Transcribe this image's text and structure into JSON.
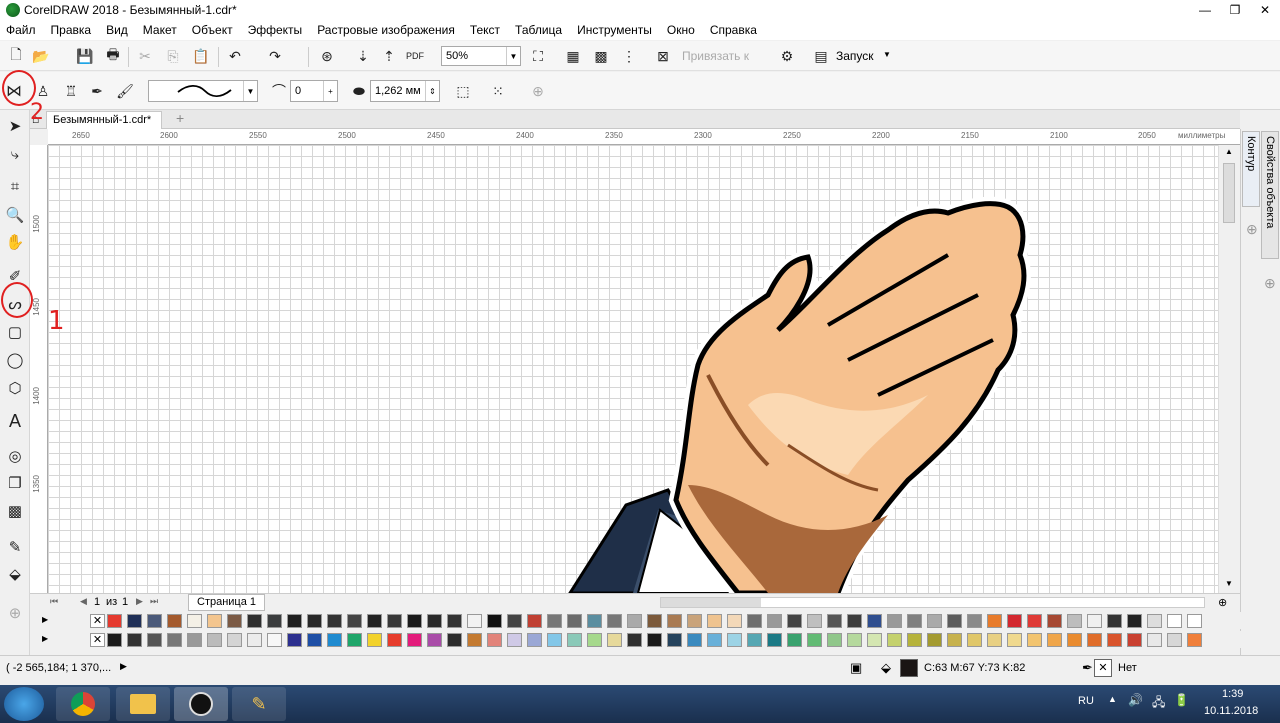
{
  "window": {
    "title": "CorelDRAW 2018 - Безымянный-1.cdr*",
    "min": "—",
    "max": "❐",
    "close": "✕"
  },
  "menu": [
    "Файл",
    "Правка",
    "Вид",
    "Макет",
    "Объект",
    "Эффекты",
    "Растровые изображения",
    "Текст",
    "Таблица",
    "Инструменты",
    "Окно",
    "Справка"
  ],
  "std": {
    "zoom": "50%",
    "snap": "Привязать к",
    "launch": "Запуск"
  },
  "prop": {
    "smooth": "0",
    "outline": "1,262 мм"
  },
  "doc": {
    "tab": "Безымянный-1.cdr*",
    "units": "миллиметры"
  },
  "hruler": [
    "2650",
    "2600",
    "2550",
    "2500",
    "2450",
    "2400",
    "2350",
    "2300",
    "2250",
    "2200",
    "2150",
    "2100",
    "2050"
  ],
  "vruler": [
    "1500",
    "1450",
    "1400",
    "1350"
  ],
  "pager": {
    "current": "1",
    "of": "из",
    "total": "1",
    "page_tab": "Страница 1"
  },
  "dock": {
    "tab1": "Контур",
    "tab2": "Свойства объекта"
  },
  "status": {
    "coords": "( -2 565,184; 1 370,... ",
    "fill_label": "C:63 M:67 Y:73 K:82",
    "outline_label": "Нет"
  },
  "annotations": {
    "a1": "1",
    "a2": "2"
  },
  "taskbar": {
    "lang": "RU",
    "time": "1:39",
    "date": "10.11.2018"
  },
  "palette_row1": [
    "#e53a2f",
    "#1f2f57",
    "#4b5a7a",
    "#a45a2d",
    "#f4f0e6",
    "#f3c58e",
    "#7b5a45",
    "#2e2e2e",
    "#3b3d3e",
    "#1f1f1f",
    "#282828",
    "#333",
    "#444",
    "#222",
    "#383838",
    "#1a1a1a",
    "#2a2a2a",
    "#333",
    "#f2f2f2",
    "#111",
    "#444",
    "#c04033",
    "#777",
    "#6b6b6b",
    "#5b8ea0",
    "#777",
    "#aaa",
    "#7c5a3b",
    "#a97a52",
    "#c9a37a",
    "#efc38f",
    "#f3d8b8",
    "#6e6e6e",
    "#999",
    "#444",
    "#bfbfbf",
    "#555",
    "#3c3c3c",
    "#2f4e8f",
    "#999",
    "#7f7f7f",
    "#aaa",
    "#5c5c5c",
    "#8a8a8a",
    "#e87b2b",
    "#d3282f",
    "#df3a36",
    "#a64832",
    "#bdbdbd",
    "#f0f0f0",
    "#333",
    "#222",
    "#ddd",
    "#fff",
    "#fff"
  ],
  "palette_row2": [
    "#1b1b1b",
    "#333",
    "#555",
    "#777",
    "#999",
    "#bbb",
    "#d4d4d4",
    "#ececec",
    "#f7f7f7",
    "#2c2f8f",
    "#1e4fa6",
    "#1f8bd0",
    "#1fa66a",
    "#f2d22b",
    "#e63c2c",
    "#e31b7b",
    "#a94ca8",
    "#2c2c2c",
    "#c47a30",
    "#e2837a",
    "#cfc9e6",
    "#9aa7d5",
    "#83c7e8",
    "#8ac9b8",
    "#a6d98c",
    "#e6d99b",
    "#2f2f2f",
    "#1a1a1a",
    "#25435d",
    "#3a8abf",
    "#68b0d9",
    "#9cd3e5",
    "#56a7b3",
    "#1b7a86",
    "#39a26e",
    "#62bb74",
    "#90c78a",
    "#b5d99d",
    "#d4e6b1",
    "#c4d16d",
    "#b6b33b",
    "#a39a2f",
    "#c7b24d",
    "#e0c769",
    "#e8d083",
    "#f0d98e",
    "#f2c46f",
    "#f0a64a",
    "#e98b2f",
    "#e06d2a",
    "#d9542c",
    "#c94030",
    "#e8e8e8",
    "#d7d7d7",
    "#f07f3a"
  ]
}
